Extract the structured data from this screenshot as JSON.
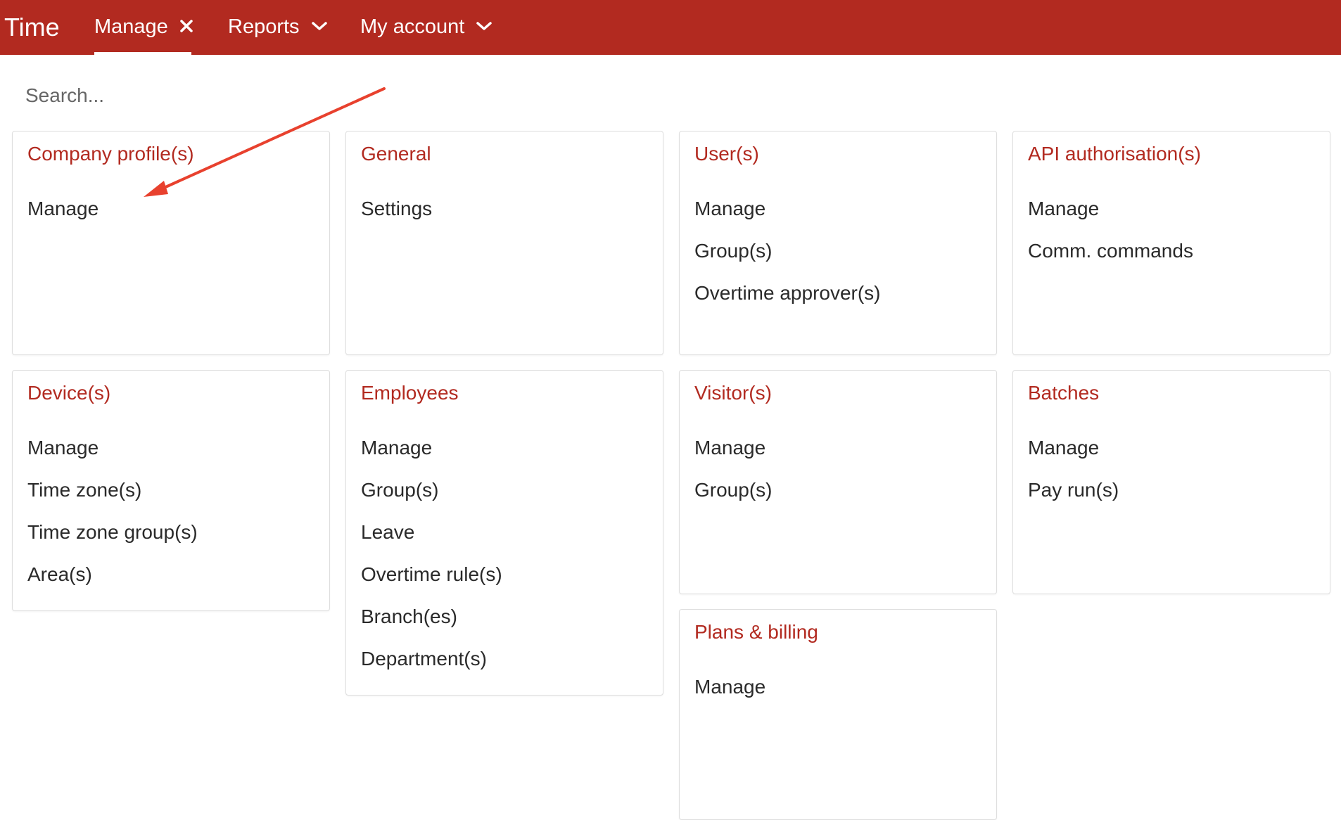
{
  "header": {
    "app_title": "Time",
    "nav": [
      {
        "label": "Manage",
        "icon": "close-icon",
        "active": true
      },
      {
        "label": "Reports",
        "icon": "chevron-down-icon"
      },
      {
        "label": "My account",
        "icon": "chevron-down-icon"
      }
    ],
    "bar_color": "#b22a20"
  },
  "search": {
    "placeholder": "Search..."
  },
  "cards": [
    {
      "title": "Company profile(s)",
      "links": [
        "Manage"
      ]
    },
    {
      "title": "General",
      "links": [
        "Settings"
      ]
    },
    {
      "title": "User(s)",
      "links": [
        "Manage",
        "Group(s)",
        "Overtime approver(s)"
      ]
    },
    {
      "title": "API authorisation(s)",
      "links": [
        "Manage",
        "Comm. commands"
      ]
    },
    {
      "title": "Device(s)",
      "links": [
        "Manage",
        "Time zone(s)",
        "Time zone group(s)",
        "Area(s)"
      ]
    },
    {
      "title": "Employees",
      "links": [
        "Manage",
        "Group(s)",
        "Leave",
        "Overtime rule(s)",
        "Branch(es)",
        "Department(s)"
      ]
    },
    {
      "title": "Visitor(s)",
      "links": [
        "Manage",
        "Group(s)"
      ]
    },
    {
      "title": "Batches",
      "links": [
        "Manage",
        "Pay run(s)"
      ]
    },
    {
      "title": "Plans & billing",
      "links": [
        "Manage"
      ]
    }
  ],
  "annotation": {
    "arrow_color": "#e8412e"
  }
}
